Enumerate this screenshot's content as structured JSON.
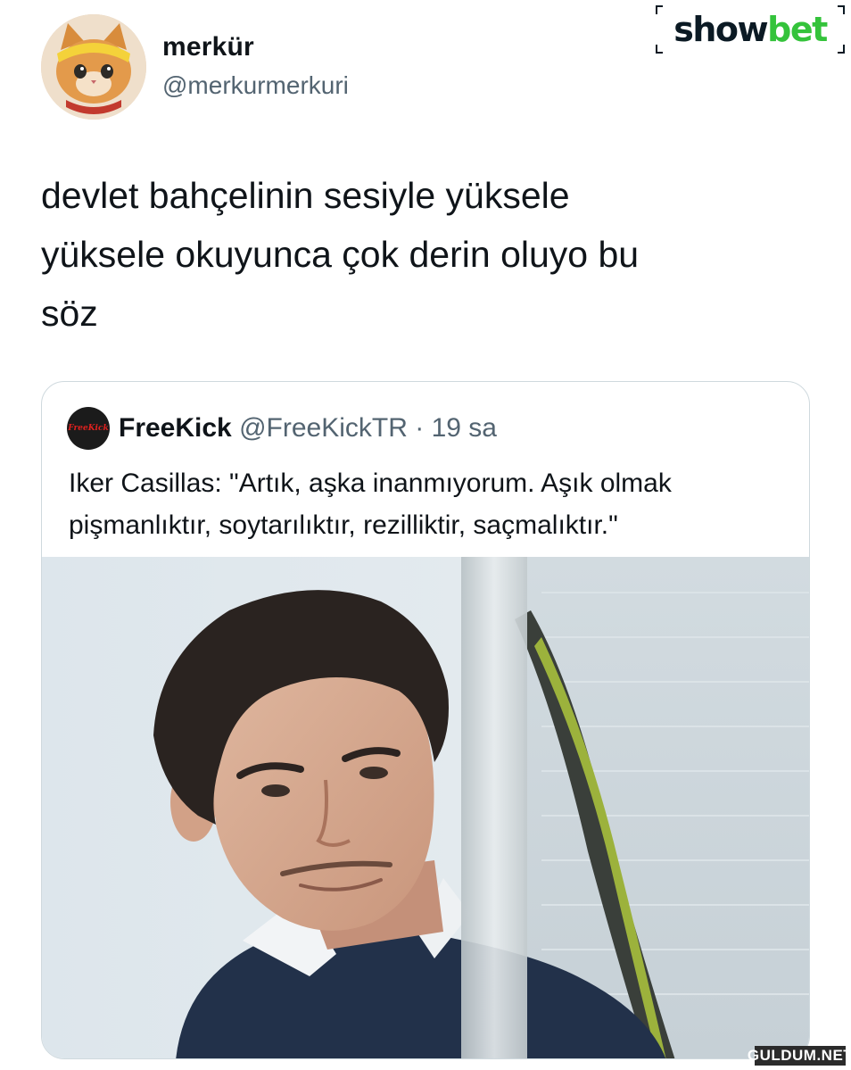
{
  "author": {
    "display_name": "merkür",
    "handle": "@merkurmerkuri"
  },
  "brand": {
    "logo_part1": "show",
    "logo_part2": "bet",
    "color_dark": "#0b1a24",
    "color_green": "#34c33b"
  },
  "tweet": {
    "text": "devlet bahçelinin sesiyle yüksele\nyüksele okuyunca çok derin oluyo bu\nsöz"
  },
  "quoted_tweet": {
    "avatar_text": "FreeKick",
    "display_name": "FreeKick",
    "handle": "@FreeKickTR",
    "separator": "·",
    "time": "19 sa",
    "text": "Iker Casillas: \"Artık, aşka inanmıyorum. Aşık olmak pişmanlıktır, soytarılıktır, rezilliktir, saçmalıktır.\""
  },
  "watermark": {
    "text": "GULDUM.NET"
  }
}
